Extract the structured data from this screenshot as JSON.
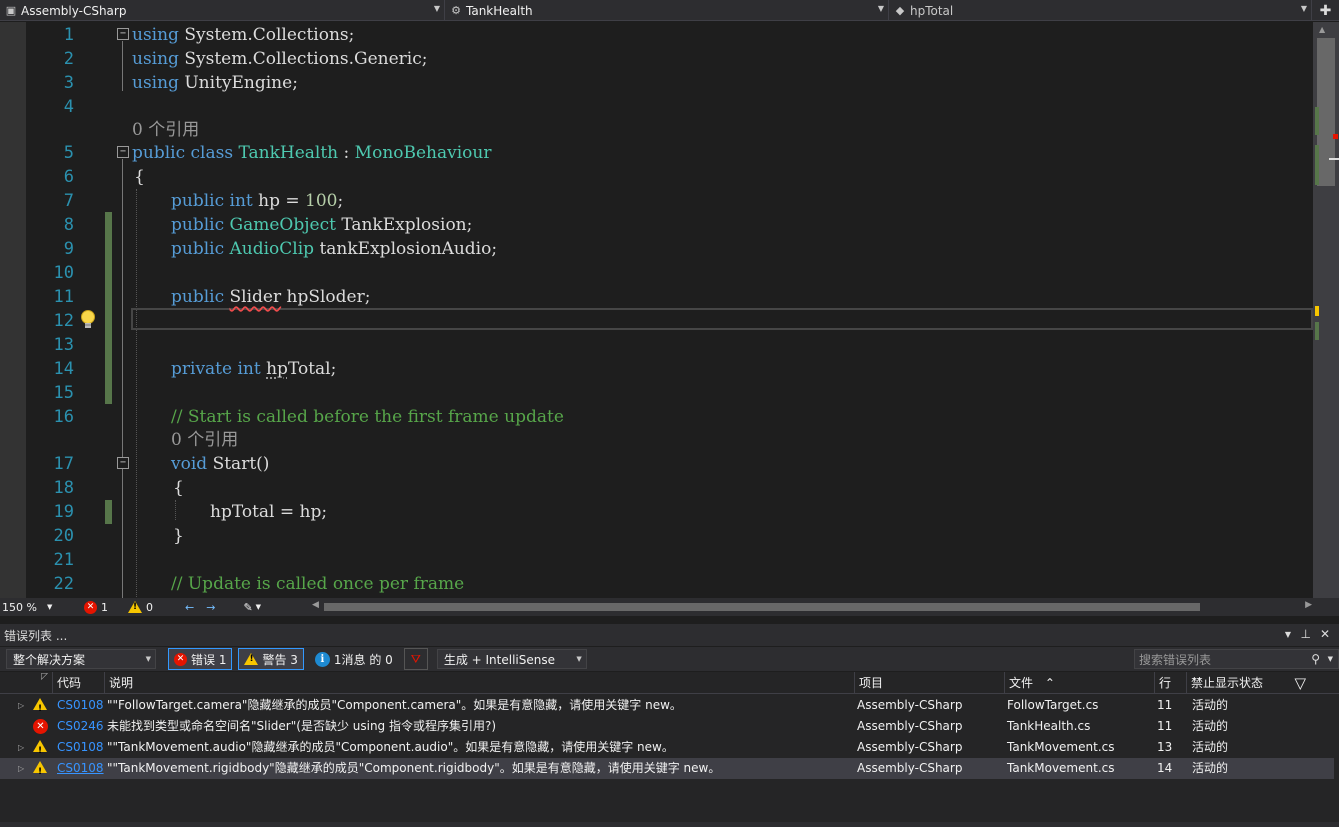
{
  "navbar": {
    "project": "Assembly-CSharp",
    "type": "TankHealth",
    "member": "hpTotal"
  },
  "editor": {
    "lines": [
      {
        "num": "1",
        "text": "using System.Collections;"
      },
      {
        "num": "2",
        "text": "using System.Collections.Generic;"
      },
      {
        "num": "3",
        "text": "using UnityEngine;"
      },
      {
        "num": "4",
        "text": ""
      },
      {
        "num": "",
        "text": "0 个引用"
      },
      {
        "num": "5",
        "text": "public class TankHealth : MonoBehaviour"
      },
      {
        "num": "6",
        "text": "{"
      },
      {
        "num": "7",
        "text": "public int hp = 100;"
      },
      {
        "num": "8",
        "text": "public GameObject TankExplosion;"
      },
      {
        "num": "9",
        "text": "public AudioClip tankExplosionAudio;"
      },
      {
        "num": "10",
        "text": ""
      },
      {
        "num": "11",
        "text": "public Slider hpSloder;"
      },
      {
        "num": "12",
        "text": ""
      },
      {
        "num": "13",
        "text": ""
      },
      {
        "num": "14",
        "text": "private int hpTotal;"
      },
      {
        "num": "15",
        "text": ""
      },
      {
        "num": "16",
        "text": "// Start is called before the first frame update"
      },
      {
        "num": "",
        "text": "0 个引用"
      },
      {
        "num": "17",
        "text": "void Start()"
      },
      {
        "num": "18",
        "text": "{"
      },
      {
        "num": "19",
        "text": "hpTotal = hp;"
      },
      {
        "num": "20",
        "text": "}"
      },
      {
        "num": "21",
        "text": ""
      },
      {
        "num": "22",
        "text": "// Update is called once per frame"
      }
    ]
  },
  "status": {
    "zoom": "150 %",
    "errors": "1",
    "warnings": "0"
  },
  "error_list": {
    "title": "错误列表 ...",
    "scope": "整个解决方案",
    "error_filter": "错误 1",
    "warning_filter": "警告 3",
    "message_filter": "1消息 的 0",
    "build_source": "生成 + IntelliSense",
    "search_placeholder": "搜索错误列表",
    "columns": {
      "code": "代码",
      "description": "说明",
      "project": "项目",
      "file": "文件",
      "line": "行",
      "suppression": "禁止显示状态"
    },
    "rows": [
      {
        "severity": "warning",
        "code": "CS0108",
        "description": "\"\"FollowTarget.camera\"隐藏继承的成员\"Component.camera\"。如果是有意隐藏，请使用关键字 new。",
        "project": "Assembly-CSharp",
        "file": "FollowTarget.cs",
        "line": "11",
        "state": "活动的"
      },
      {
        "severity": "error",
        "code": "CS0246",
        "description": "未能找到类型或命名空间名\"Slider\"(是否缺少 using 指令或程序集引用?)",
        "project": "Assembly-CSharp",
        "file": "TankHealth.cs",
        "line": "11",
        "state": "活动的"
      },
      {
        "severity": "warning",
        "code": "CS0108",
        "description": "\"\"TankMovement.audio\"隐藏继承的成员\"Component.audio\"。如果是有意隐藏，请使用关键字 new。",
        "project": "Assembly-CSharp",
        "file": "TankMovement.cs",
        "line": "13",
        "state": "活动的"
      },
      {
        "severity": "warning",
        "code": "CS0108",
        "description": "\"\"TankMovement.rigidbody\"隐藏继承的成员\"Component.rigidbody\"。如果是有意隐藏，请使用关键字 new。",
        "project": "Assembly-CSharp",
        "file": "TankMovement.cs",
        "line": "14",
        "state": "活动的"
      }
    ]
  },
  "colors": {
    "keyword": "#569cd6",
    "type": "#4ec9b0",
    "comment": "#57a64a",
    "line_number": "#2b91af",
    "link": "#3794ff",
    "error": "#e51400",
    "warning": "#f7c600"
  }
}
